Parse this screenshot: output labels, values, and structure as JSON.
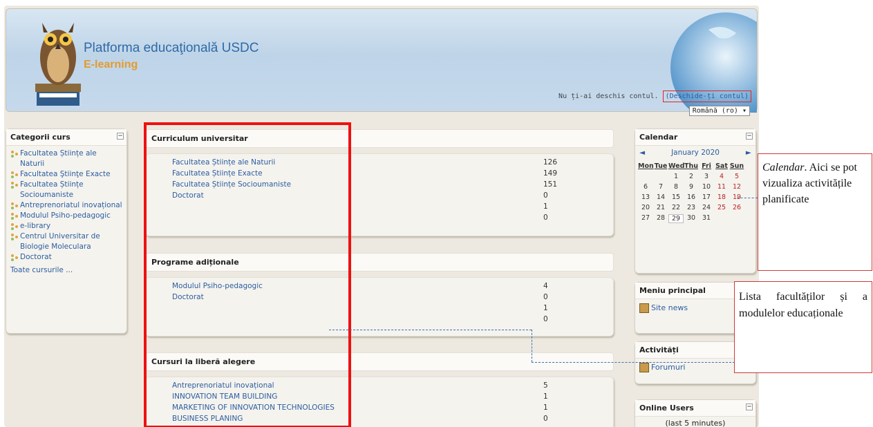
{
  "header": {
    "title": "Platforma educaţională USDC",
    "subtitle": "E-learning",
    "login_prompt": "Nu ți-ai deschis contul.",
    "login_link": "(Deschide-ți contul)",
    "language": "Română (ro) ▾"
  },
  "categories": {
    "title": "Categorii curs",
    "items": [
      "Facultatea Științe ale Naturii",
      "Facultatea Ştiinţe Exacte",
      "Facultatea Științe Socioumaniste",
      "Antreprenoriatul inovațional",
      "Modulul Psiho-pedagogic",
      "e-library",
      "Centrul Universitar de Biologie Moleculara",
      "Doctorat"
    ],
    "all_courses": "Toate cursurile ..."
  },
  "sections": [
    {
      "title": "Curriculum universitar",
      "rows": [
        {
          "name": "Facultatea Științe ale Naturii",
          "count": "126"
        },
        {
          "name": "Facultatea Științe Exacte",
          "count": "149"
        },
        {
          "name": "Facultatea Științe Socioumaniste",
          "count": "151"
        },
        {
          "name": "Doctorat",
          "count": "0"
        },
        {
          "name": "",
          "count": "1"
        },
        {
          "name": "",
          "count": "0"
        }
      ]
    },
    {
      "title": "Programe adiționale",
      "rows": [
        {
          "name": "Modulul Psiho-pedagogic",
          "count": "4"
        },
        {
          "name": "Doctorat",
          "count": "0"
        },
        {
          "name": "",
          "count": "1"
        },
        {
          "name": "",
          "count": "0"
        }
      ]
    },
    {
      "title": "Cursuri la liberă alegere",
      "rows": [
        {
          "name": "Antreprenoriatul inovațional",
          "count": "5"
        },
        {
          "name": "INNOVATION TEAM BUILDING",
          "count": "1"
        },
        {
          "name": "MARKETING OF INNOVATION TECHNOLOGIES",
          "count": "1"
        },
        {
          "name": "BUSINESS PLANING",
          "count": "0"
        }
      ]
    }
  ],
  "calendar": {
    "title": "Calendar",
    "prev": "◄",
    "next": "►",
    "month": "January 2020",
    "day_names": [
      "Mon",
      "Tue",
      "Wed",
      "Thu",
      "Fri",
      "Sat",
      "Sun"
    ],
    "days": [
      "",
      "",
      "1",
      "2",
      "3",
      "4",
      "5",
      "6",
      "7",
      "8",
      "9",
      "10",
      "11",
      "12",
      "13",
      "14",
      "15",
      "16",
      "17",
      "18",
      "19",
      "20",
      "21",
      "22",
      "23",
      "24",
      "25",
      "26",
      "27",
      "28",
      "29",
      "30",
      "31"
    ],
    "today": "29"
  },
  "main_menu": {
    "title": "Meniu principal",
    "item": "Site news"
  },
  "activities": {
    "title": "Activități",
    "item": "Forumuri"
  },
  "online_users": {
    "title": "Online Users",
    "note": "(last 5 minutes)"
  },
  "annotations": {
    "calendar_title": "Calendar",
    "calendar_text": ". Aici se pot vizualiza activitățile planificate",
    "faculties_text": "Lista facultăților și a modulelor educaționale"
  },
  "colors": {
    "accent_red": "#e11111",
    "link": "#2a5da0",
    "subtitle": "#e39b2f"
  }
}
